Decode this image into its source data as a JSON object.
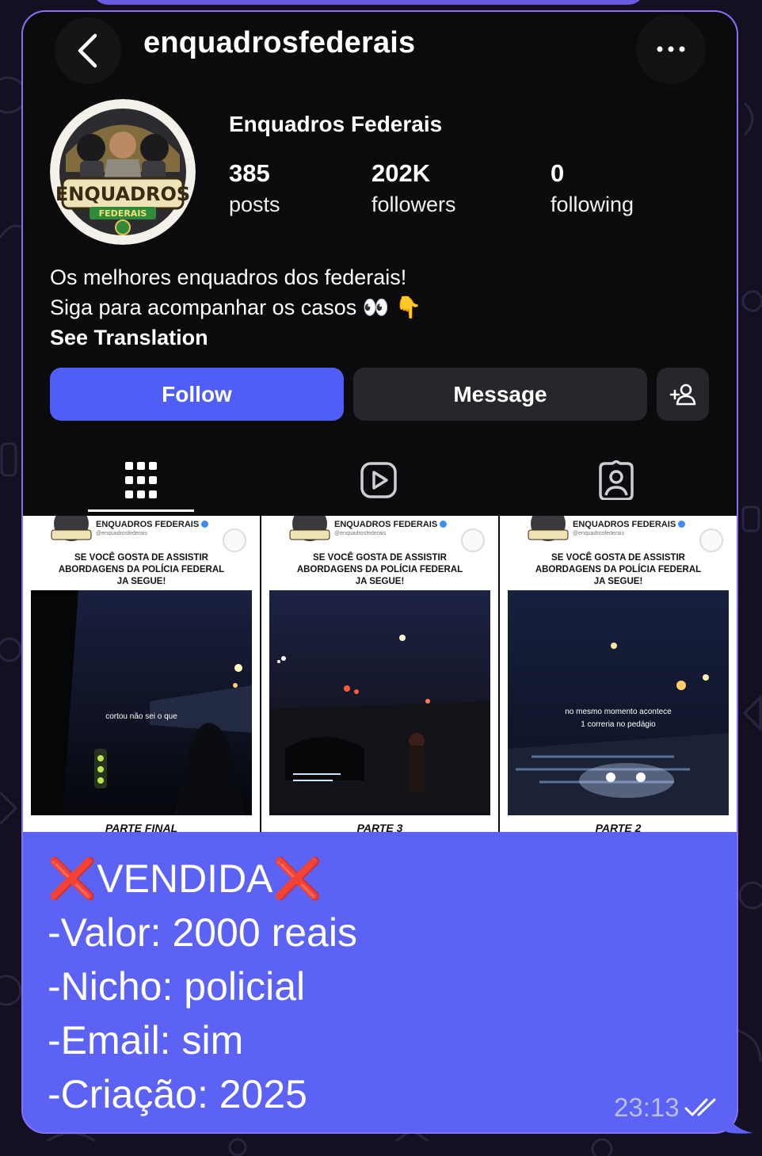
{
  "chat": {
    "bubble_color": "#5b62f4",
    "time": "23:13",
    "status_icon": "double-check-icon",
    "message_lines": [
      {
        "prefix": "❌",
        "text": "VENDIDA",
        "suffix": "❌"
      },
      {
        "text": "-Valor: 2000 reais"
      },
      {
        "text": "-Nicho: policial"
      },
      {
        "text": "-Email: sim"
      },
      {
        "text": "-Criação: 2025"
      }
    ]
  },
  "profile": {
    "username": "enquadrosfederais",
    "display_name": "Enquadros Federais",
    "avatar": {
      "brand": "ENQUADROS",
      "sub": "FEDERAIS"
    },
    "stats": [
      {
        "value": "385",
        "label": "posts"
      },
      {
        "value": "202K",
        "label": "followers"
      },
      {
        "value": "0",
        "label": "following"
      }
    ],
    "bio_lines": [
      "Os melhores enquadros dos federais!",
      "Siga para acompanhar os casos 👀 👇"
    ],
    "see_translation": "See Translation",
    "buttons": {
      "follow": "Follow",
      "message": "Message"
    },
    "follow_color": "#4f5ef7",
    "tabs": [
      "grid-icon",
      "reels-icon",
      "tagged-icon"
    ]
  },
  "posts": [
    {
      "brand": "ENQUADROS FEDERAIS",
      "handle": "@enquadrosfederais",
      "caption": [
        "SE VOCÊ GOSTA DE ASSISTIR",
        "ABORDAGENS DA POLÍCIA FEDERAL",
        "JA SEGUE!"
      ],
      "subtitle": [
        "cortou não sei o que"
      ],
      "part": "PARTE FINAL"
    },
    {
      "brand": "ENQUADROS FEDERAIS",
      "handle": "@enquadrosfederais",
      "caption": [
        "SE VOCÊ GOSTA DE ASSISTIR",
        "ABORDAGENS DA POLÍCIA FEDERAL",
        "JA SEGUE!"
      ],
      "subtitle": [],
      "part": "PARTE 3"
    },
    {
      "brand": "ENQUADROS FEDERAIS",
      "handle": "@enquadrosfederais",
      "caption": [
        "SE VOCÊ GOSTA DE ASSISTIR",
        "ABORDAGENS DA POLÍCIA FEDERAL",
        "JA SEGUE!"
      ],
      "subtitle": [
        "no mesmo momento acontece",
        "1 correria no pedágio"
      ],
      "part": "PARTE 2"
    }
  ]
}
